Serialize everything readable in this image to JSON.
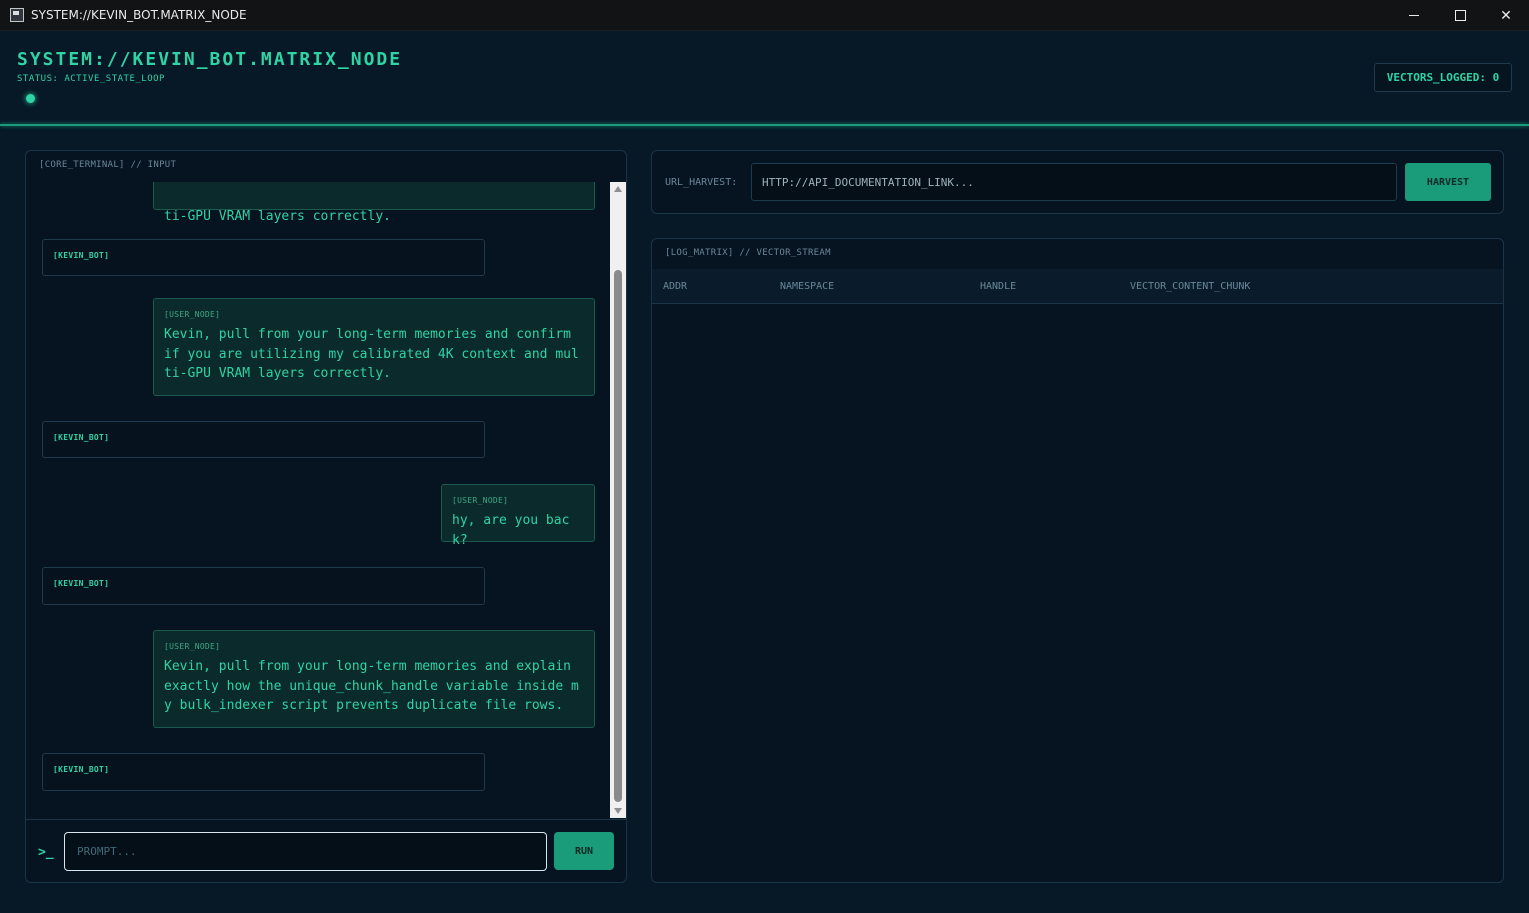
{
  "window": {
    "title": "SYSTEM://KEVIN_BOT.MATRIX_NODE",
    "controls": [
      "minimize",
      "maximize",
      "close"
    ]
  },
  "header": {
    "title": "SYSTEM://KEVIN_BOT.MATRIX_NODE",
    "status": "STATUS: ACTIVE_STATE_LOOP",
    "vectors_logged": "VECTORS_LOGGED: 0"
  },
  "terminal": {
    "label": "[CORE_TERMINAL] // INPUT",
    "messages": [
      {
        "role": "user",
        "author": "[USER_NODE]",
        "text": "ti-GPU VRAM layers correctly."
      },
      {
        "role": "bot",
        "author": "[KEVIN_BOT]",
        "text": ""
      },
      {
        "role": "user",
        "author": "[USER_NODE]",
        "text": "Kevin, pull from your long-term memories and confirm if you are utilizing my calibrated 4K context and multi-GPU VRAM layers correctly."
      },
      {
        "role": "bot",
        "author": "[KEVIN_BOT]",
        "text": ""
      },
      {
        "role": "user",
        "author": "[USER_NODE]",
        "text": "hy, are you back?"
      },
      {
        "role": "bot",
        "author": "[KEVIN_BOT]",
        "text": ""
      },
      {
        "role": "user",
        "author": "[USER_NODE]",
        "text": "Kevin, pull from your long-term memories and explain exactly how the unique_chunk_handle variable inside my bulk_indexer script prevents duplicate file rows."
      },
      {
        "role": "bot",
        "author": "[KEVIN_BOT]",
        "text": ""
      }
    ],
    "prompt_glyph": ">_",
    "prompt_placeholder": "PROMPT...",
    "prompt_value": "",
    "run_label": "RUN"
  },
  "harvest": {
    "label": "URL_HARVEST:",
    "placeholder": "HTTP://API_DOCUMENTATION_LINK...",
    "value": "",
    "button_label": "HARVEST"
  },
  "log": {
    "label": "[LOG_MATRIX] // VECTOR_STREAM",
    "columns": [
      "ADDR",
      "NAMESPACE",
      "HANDLE",
      "VECTOR_CONTENT_CHUNK"
    ],
    "rows": []
  },
  "colors": {
    "accent": "#2fd3a4",
    "button": "#1a9c7b",
    "background": "#071826",
    "panel": "#061420"
  }
}
